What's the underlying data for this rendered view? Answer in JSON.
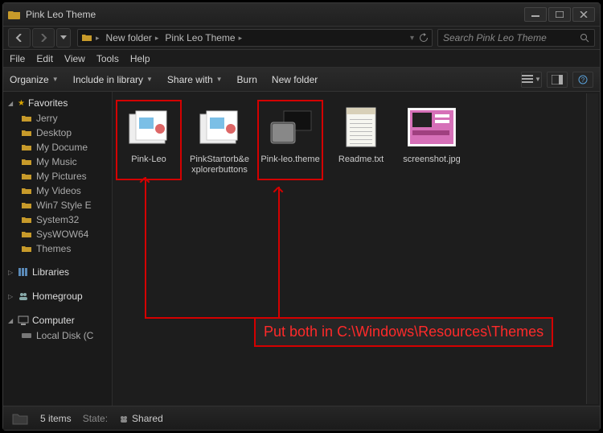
{
  "window": {
    "title": "Pink Leo Theme"
  },
  "breadcrumbs": [
    {
      "label": ""
    },
    {
      "label": "New folder"
    },
    {
      "label": "Pink Leo Theme"
    }
  ],
  "search": {
    "placeholder": "Search Pink Leo Theme"
  },
  "menubar": [
    "File",
    "Edit",
    "View",
    "Tools",
    "Help"
  ],
  "toolbar": {
    "organize": "Organize",
    "include": "Include in library",
    "share": "Share with",
    "burn": "Burn",
    "newfolder": "New folder"
  },
  "sidebar": {
    "favorites": {
      "header": "Favorites",
      "items": [
        "Jerry",
        "Desktop",
        "My Docume",
        "My Music",
        "My Pictures",
        "My Videos",
        "Win7 Style E",
        "System32",
        "SysWOW64",
        "Themes"
      ]
    },
    "libraries": {
      "header": "Libraries"
    },
    "homegroup": {
      "header": "Homegroup"
    },
    "computer": {
      "header": "Computer",
      "items": [
        "Local Disk (C"
      ]
    }
  },
  "files": [
    {
      "name": "Pink-Leo",
      "type": "folder-open",
      "boxed": true
    },
    {
      "name": "PinkStartorb&explorerbuttons",
      "type": "folder-open"
    },
    {
      "name": "Pink-leo.theme",
      "type": "theme",
      "boxed": true
    },
    {
      "name": "Readme.txt",
      "type": "txt"
    },
    {
      "name": "screenshot.jpg",
      "type": "image"
    }
  ],
  "annotation": "Put both in C:\\Windows\\Resources\\Themes",
  "statusbar": {
    "count": "5 items",
    "state_label": "State:",
    "state_value": "Shared"
  }
}
